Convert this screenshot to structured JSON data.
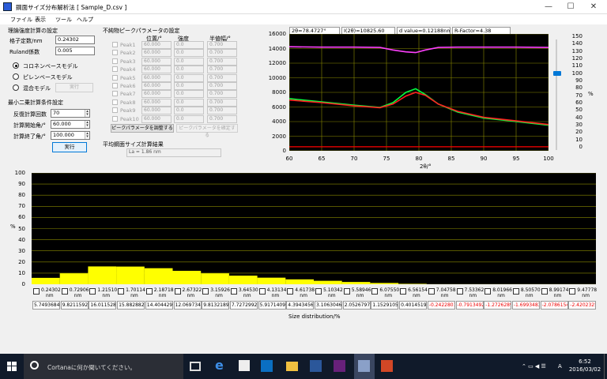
{
  "window": {
    "title": "鋼面サイズ分布解析法 [ Sample_D.csv ]",
    "controls": [
      "—",
      "☐",
      "✕"
    ]
  },
  "menu": [
    "ファイル",
    "表示",
    "ツール",
    "ヘルプ"
  ],
  "theory": {
    "group_label": "理論強度計算の設定",
    "lattice_label": "格子定数/nm",
    "lattice_value": "0.24302",
    "ruland_label": "Ruland係数",
    "ruland_value": "0.005",
    "models": [
      "コロネンベースモデル",
      "ピレンベースモデル",
      "混合モデル"
    ],
    "selected_model": 0,
    "run_disabled_label": "実行"
  },
  "lsq": {
    "group_label": "最小二乗計算条件設定",
    "iter_label": "反復計算回数",
    "iter_value": "70",
    "start_label": "計算開始角/°",
    "start_value": "60.000",
    "end_label": "計算終了角/°",
    "end_value": "100.000",
    "run_label": "実行"
  },
  "impurity": {
    "group_label": "不純物ピークパラメータの設定",
    "headers": [
      "位置/°",
      "強度",
      "半値幅/°"
    ],
    "peaks": [
      {
        "name": "Peak1",
        "pos": "60.000",
        "int": "0.0",
        "fwhm": "0.700"
      },
      {
        "name": "Peak2",
        "pos": "60.000",
        "int": "0.0",
        "fwhm": "0.700"
      },
      {
        "name": "Peak3",
        "pos": "60.000",
        "int": "0.0",
        "fwhm": "0.700"
      },
      {
        "name": "Peak4",
        "pos": "60.000",
        "int": "0.0",
        "fwhm": "0.700"
      },
      {
        "name": "Peak5",
        "pos": "60.000",
        "int": "0.0",
        "fwhm": "0.700"
      },
      {
        "name": "Peak6",
        "pos": "60.000",
        "int": "0.0",
        "fwhm": "0.700"
      },
      {
        "name": "Peak7",
        "pos": "60.000",
        "int": "0.0",
        "fwhm": "0.700"
      },
      {
        "name": "Peak8",
        "pos": "60.000",
        "int": "0.0",
        "fwhm": "0.700"
      },
      {
        "name": "Peak9",
        "pos": "60.000",
        "int": "0.0",
        "fwhm": "0.700"
      },
      {
        "name": "Peak10",
        "pos": "60.000",
        "int": "0.0",
        "fwhm": "0.700"
      }
    ],
    "adjust_label": "ピークパラメータを調整する",
    "confirm_label": "ピークパラメータを確定する"
  },
  "result": {
    "group_label": "平均鋼面サイズ計算結果",
    "la_value": "La = 1.86 nm"
  },
  "readouts": {
    "two_theta": "2θ=78.4727°",
    "intensity": "I(2θ)=10825.60",
    "d_value": "d value=0.12188nm",
    "r_factor": "R-Factor=4.38"
  },
  "chart_data": [
    {
      "type": "line",
      "x_ticks": [
        60,
        65,
        70,
        75,
        80,
        85,
        90,
        95,
        100
      ],
      "y_ticks": [
        0,
        2000,
        4000,
        6000,
        8000,
        10000,
        12000,
        14000,
        16000
      ],
      "right_ticks": [
        0,
        10,
        20,
        30,
        40,
        50,
        60,
        70,
        80,
        90,
        100,
        110,
        120,
        130,
        140,
        150
      ],
      "xlabel": "2θ/°",
      "right_unit": "%",
      "slider_value": 100,
      "xlim": [
        60,
        100
      ],
      "ylim": [
        0,
        16000
      ],
      "series": [
        {
          "color": "#ff40ff",
          "x": [
            60,
            65,
            70,
            74,
            76,
            78,
            79.5,
            81,
            83,
            86,
            90,
            95,
            100
          ],
          "y": [
            14250,
            14200,
            14200,
            14150,
            13800,
            13550,
            13450,
            13800,
            14150,
            14200,
            14200,
            14200,
            14150
          ]
        },
        {
          "color": "#00ff40",
          "x": [
            60,
            65,
            70,
            74,
            76,
            78,
            79.5,
            81,
            83,
            86,
            90,
            95,
            100
          ],
          "y": [
            7150,
            6700,
            6250,
            5950,
            6600,
            8000,
            8500,
            7700,
            6400,
            5300,
            4500,
            4000,
            3500
          ]
        },
        {
          "color": "#ff2020",
          "x": [
            60,
            65,
            70,
            74,
            76,
            78,
            79.5,
            81,
            83,
            86,
            90,
            95,
            100
          ],
          "y": [
            6950,
            6600,
            6150,
            5900,
            6400,
            7500,
            8000,
            7600,
            6400,
            5400,
            4600,
            4100,
            3600
          ]
        },
        {
          "color": "#ff0000",
          "x": [
            60,
            100
          ],
          "y": [
            550,
            550
          ]
        }
      ]
    },
    {
      "type": "bar",
      "ylabel": "%",
      "xlabel": "Size distribution/%",
      "y_ticks": [
        0,
        10,
        20,
        30,
        40,
        50,
        60,
        70,
        80,
        90,
        100
      ],
      "ylim": [
        0,
        100
      ],
      "categories": [
        "0.24302",
        "0.72906",
        "1.21510",
        "1.70114",
        "2.18718",
        "2.67322",
        "3.15926",
        "3.64530",
        "4.13134",
        "4.61738",
        "5.10342",
        "5.58946",
        "6.07550",
        "6.56154",
        "7.04758",
        "7.53362",
        "8.01966",
        "8.50570",
        "8.99174",
        "9.47778"
      ],
      "unit": "nm",
      "values": [
        5.74936845,
        9.8211592,
        16.0115285,
        15.882882,
        14.4044296,
        12.0697345,
        9.81321894,
        7.7272992,
        5.91714096,
        4.39434565,
        3.10630465,
        2.05267973,
        1.15291053,
        0.4014519,
        -0.2422801,
        -0.7913492,
        -1.2726289,
        -1.6993483,
        -2.0786154,
        -2.4202325
      ],
      "labels": [
        "5.74936845",
        "9.82115920",
        "16.0115285",
        "15.8828820",
        "14.4044296",
        "12.0697345",
        "9.81321894",
        "7.72729920",
        "5.91714096",
        "4.39434565",
        "3.10630465",
        "2.05267973",
        "1.15291053",
        "0.40145190",
        "-0.2422801",
        "-0.7913492",
        "-1.2726289",
        "-1.6993483",
        "-2.0786154",
        "-2.4202325"
      ],
      "positive_color": "#ffff00",
      "negative_color": "#d40000"
    }
  ],
  "taskbar": {
    "search_placeholder": "Cortanaに何か聞いてください。",
    "time": "6:52",
    "date": "2016/03/02",
    "ime": "A"
  }
}
